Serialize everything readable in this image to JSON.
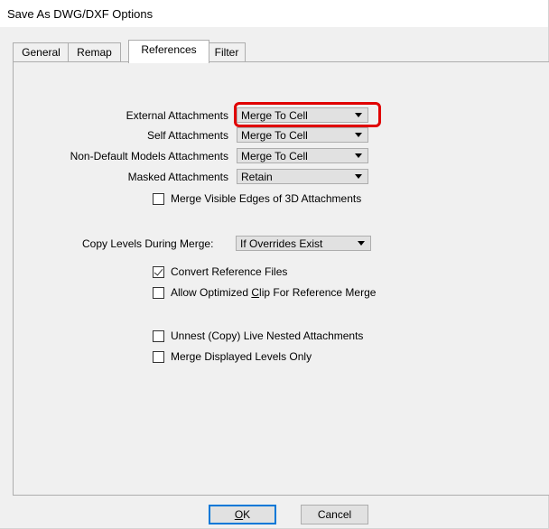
{
  "window": {
    "title": "Save As DWG/DXF Options"
  },
  "tabs": [
    {
      "label": "General"
    },
    {
      "label": "Remap"
    },
    {
      "label": "References"
    },
    {
      "label": "Filter"
    }
  ],
  "active_tab": "References",
  "fields": {
    "external": {
      "label": "External Attachments",
      "value": "Merge To Cell"
    },
    "self": {
      "label": "Self Attachments",
      "value": "Merge To Cell"
    },
    "nondefault": {
      "label": "Non-Default Models Attachments",
      "value": "Merge To Cell"
    },
    "masked": {
      "label": "Masked Attachments",
      "value": "Retain"
    },
    "copy_levels": {
      "label": "Copy Levels During Merge:",
      "value": "If Overrides Exist"
    }
  },
  "checkboxes": {
    "merge_visible_edges": {
      "label": "Merge Visible Edges of 3D Attachments",
      "checked": false
    },
    "convert_ref": {
      "label": "Convert Reference Files",
      "checked": true
    },
    "allow_clip_pre": "Allow Optimized ",
    "allow_clip_u": "C",
    "allow_clip_post": "lip For Reference Merge",
    "allow_clip_checked": false,
    "unnest": {
      "label": "Unnest (Copy) Live Nested Attachments",
      "checked": false
    },
    "merge_levels": {
      "label": "Merge Displayed Levels Only",
      "checked": false
    }
  },
  "buttons": {
    "ok_u": "O",
    "ok_rest": "K",
    "cancel": "Cancel"
  },
  "colors": {
    "highlight": "#e00000",
    "default_button": "#0078d7"
  }
}
